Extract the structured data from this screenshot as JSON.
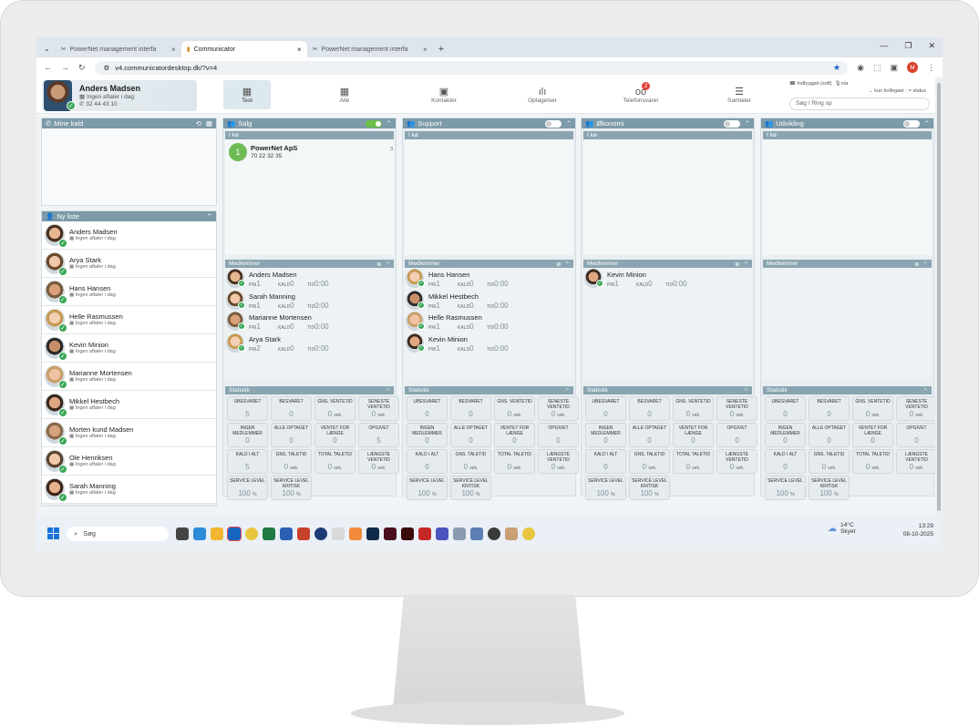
{
  "browser": {
    "tabs": [
      {
        "label": "PowerNet management interfa"
      },
      {
        "label": "Communicator"
      },
      {
        "label": "PowerNet management interfa"
      }
    ],
    "url": "v4.communicatordesktop.dk/?v=4",
    "profile_initial": "M"
  },
  "user": {
    "name": "Anders Madsen",
    "status": "Ingen aftaler i dag",
    "phone": "32 44 43 10"
  },
  "nav": [
    {
      "label": "Test",
      "icon": "grid-icon"
    },
    {
      "label": "Alle",
      "icon": "grid-icon"
    },
    {
      "label": "Kontakter",
      "icon": "contacts-icon"
    },
    {
      "label": "Optagelser",
      "icon": "waveform-icon"
    },
    {
      "label": "Telefonsvarer",
      "icon": "voicemail-icon",
      "badge": "2"
    },
    {
      "label": "Samtaler",
      "icon": "list-icon"
    }
  ],
  "header_right": {
    "device": "Indbygget (soft)",
    "mic": "n/a",
    "filter": "→ kun kollegaer : = status",
    "search_placeholder": "Søg / Ring op"
  },
  "mine_kald": {
    "title": "Mine kald"
  },
  "ny_liste": {
    "title": "Ny liste",
    "contacts": [
      {
        "name": "Anders Madsen",
        "status": "Ingen aftaler i dag"
      },
      {
        "name": "Arya Stark",
        "status": "Ingen aftaler i dag"
      },
      {
        "name": "Hans Hansen",
        "status": "Ingen aftaler i dag"
      },
      {
        "name": "Helle Rasmussen",
        "status": "Ingen aftaler i dag"
      },
      {
        "name": "Kevin Minion",
        "status": "Ingen aftaler i dag"
      },
      {
        "name": "Marianne Mortensen",
        "status": "Ingen aftaler i dag"
      },
      {
        "name": "Mikkel Hestbech",
        "status": "Ingen aftaler i dag"
      },
      {
        "name": "Morten kund Madsen",
        "status": "Ingen aftaler i dag"
      },
      {
        "name": "Ole Henriksen",
        "status": "Ingen aftaler i dag"
      },
      {
        "name": "Sarah Manning",
        "status": "Ingen aftaler i dag"
      }
    ]
  },
  "labels": {
    "queue": "I kø",
    "members": "Medlemmer",
    "stats": "Statistik",
    "pri": "PRI",
    "kald": "KALD",
    "tid": "TID"
  },
  "groups": [
    {
      "title": "Salg",
      "toggle_on": true,
      "queue": [
        {
          "pos": "1",
          "name": "PowerNet ApS",
          "phone": "70 22 32 35",
          "count": "3"
        }
      ],
      "members": [
        {
          "name": "Anders Madsen",
          "pri": "1",
          "kald": "0",
          "tid": "0:00"
        },
        {
          "name": "Sarah Manning",
          "pri": "1",
          "kald": "0",
          "tid": "0:00"
        },
        {
          "name": "Marianne Mortensen",
          "pri": "1",
          "kald": "0",
          "tid": "0:00"
        },
        {
          "name": "Arya Stark",
          "pri": "2",
          "kald": "0",
          "tid": "0:00"
        }
      ],
      "stats": [
        {
          "label": "UBESVARET",
          "value": "5",
          "unit": ""
        },
        {
          "label": "BESVARET",
          "value": "0",
          "unit": ""
        },
        {
          "label": "GNS. VENTETID",
          "value": "0",
          "unit": "sek."
        },
        {
          "label": "SENESTE VENTETID",
          "value": "0",
          "unit": "sek."
        },
        {
          "label": "INGEN MEDLEMMER",
          "value": "0",
          "unit": ""
        },
        {
          "label": "ALLE OPTAGET",
          "value": "0",
          "unit": ""
        },
        {
          "label": "VENTET FOR LÆNGE",
          "value": "0",
          "unit": ""
        },
        {
          "label": "OPGIVET",
          "value": "5",
          "unit": ""
        },
        {
          "label": "KALD I ALT",
          "value": "5",
          "unit": ""
        },
        {
          "label": "GNS. TALETID",
          "value": "0",
          "unit": "sek."
        },
        {
          "label": "TOTAL TALETID",
          "value": "0",
          "unit": "sek."
        },
        {
          "label": "LÆNGSTE VENTETID",
          "value": "0",
          "unit": "sek."
        },
        {
          "label": "SERVICE LEVEL",
          "value": "100",
          "unit": "%"
        },
        {
          "label": "SERVICE LEVEL KRITISK",
          "value": "100",
          "unit": "%"
        }
      ]
    },
    {
      "title": "Support",
      "toggle_on": false,
      "queue": [],
      "members": [
        {
          "name": "Hans Hansen",
          "pri": "1",
          "kald": "0",
          "tid": "0:00"
        },
        {
          "name": "Mikkel Hestbech",
          "pri": "1",
          "kald": "0",
          "tid": "0:00"
        },
        {
          "name": "Helle Rasmussen",
          "pri": "1",
          "kald": "0",
          "tid": "0:00"
        },
        {
          "name": "Kevin Minion",
          "pri": "1",
          "kald": "0",
          "tid": "0:00"
        }
      ],
      "stats": [
        {
          "label": "UBESVARET",
          "value": "0",
          "unit": ""
        },
        {
          "label": "BESVARET",
          "value": "0",
          "unit": ""
        },
        {
          "label": "GNS. VENTETID",
          "value": "0",
          "unit": "sek."
        },
        {
          "label": "SENESTE VENTETID",
          "value": "0",
          "unit": "sek."
        },
        {
          "label": "INGEN MEDLEMMER",
          "value": "0",
          "unit": ""
        },
        {
          "label": "ALLE OPTAGET",
          "value": "0",
          "unit": ""
        },
        {
          "label": "VENTET FOR LÆNGE",
          "value": "0",
          "unit": ""
        },
        {
          "label": "OPGIVET",
          "value": "0",
          "unit": ""
        },
        {
          "label": "KALD I ALT",
          "value": "0",
          "unit": ""
        },
        {
          "label": "GNS. TALETID",
          "value": "0",
          "unit": "sek."
        },
        {
          "label": "TOTAL TALETID",
          "value": "0",
          "unit": "sek."
        },
        {
          "label": "LÆNGSTE VENTETID",
          "value": "0",
          "unit": "sek."
        },
        {
          "label": "SERVICE LEVEL",
          "value": "100",
          "unit": "%"
        },
        {
          "label": "SERVICE LEVEL KRITISK",
          "value": "100",
          "unit": "%"
        }
      ]
    },
    {
      "title": "Økonomi",
      "toggle_on": false,
      "queue": [],
      "members": [
        {
          "name": "Kevin Minion",
          "pri": "1",
          "kald": "0",
          "tid": "0:00"
        }
      ],
      "stats": [
        {
          "label": "UBESVARET",
          "value": "0",
          "unit": ""
        },
        {
          "label": "BESVARET",
          "value": "0",
          "unit": ""
        },
        {
          "label": "GNS. VENTETID",
          "value": "0",
          "unit": "sek."
        },
        {
          "label": "SENESTE VENTETID",
          "value": "0",
          "unit": "sek."
        },
        {
          "label": "INGEN MEDLEMMER",
          "value": "0",
          "unit": ""
        },
        {
          "label": "ALLE OPTAGET",
          "value": "0",
          "unit": ""
        },
        {
          "label": "VENTET FOR LÆNGE",
          "value": "0",
          "unit": ""
        },
        {
          "label": "OPGIVET",
          "value": "0",
          "unit": ""
        },
        {
          "label": "KALD I ALT",
          "value": "0",
          "unit": ""
        },
        {
          "label": "GNS. TALETID",
          "value": "0",
          "unit": "sek."
        },
        {
          "label": "TOTAL TALETID",
          "value": "0",
          "unit": "sek."
        },
        {
          "label": "LÆNGSTE VENTETID",
          "value": "0",
          "unit": "sek."
        },
        {
          "label": "SERVICE LEVEL",
          "value": "100",
          "unit": "%"
        },
        {
          "label": "SERVICE LEVEL KRITISK",
          "value": "100",
          "unit": "%"
        }
      ]
    },
    {
      "title": "Udvikling",
      "toggle_on": false,
      "queue": [],
      "members": [],
      "stats": [
        {
          "label": "UBESVARET",
          "value": "0",
          "unit": ""
        },
        {
          "label": "BESVARET",
          "value": "0",
          "unit": ""
        },
        {
          "label": "GNS. VENTETID",
          "value": "0",
          "unit": "sek."
        },
        {
          "label": "SENESTE VENTETID",
          "value": "0",
          "unit": "sek."
        },
        {
          "label": "INGEN MEDLEMMER",
          "value": "0",
          "unit": ""
        },
        {
          "label": "ALLE OPTAGET",
          "value": "0",
          "unit": ""
        },
        {
          "label": "VENTET FOR LÆNGE",
          "value": "0",
          "unit": ""
        },
        {
          "label": "OPGIVET",
          "value": "0",
          "unit": ""
        },
        {
          "label": "KALD I ALT",
          "value": "0",
          "unit": ""
        },
        {
          "label": "GNS. TALETID",
          "value": "0",
          "unit": "sek."
        },
        {
          "label": "TOTAL TALETID",
          "value": "0",
          "unit": "sek."
        },
        {
          "label": "LÆNGSTE VENTETID",
          "value": "0",
          "unit": "sek."
        },
        {
          "label": "SERVICE LEVEL",
          "value": "100",
          "unit": "%"
        },
        {
          "label": "SERVICE LEVEL KRITISK",
          "value": "100",
          "unit": "%"
        }
      ]
    }
  ],
  "taskbar": {
    "search": "Søg",
    "temp": "14°C",
    "weather": "Skyet",
    "time": "13:29",
    "date": "08-10-2025"
  },
  "colors": {
    "accent": "#7d9aa8",
    "online": "#3aa757",
    "queue_green": "#6fbb56"
  }
}
